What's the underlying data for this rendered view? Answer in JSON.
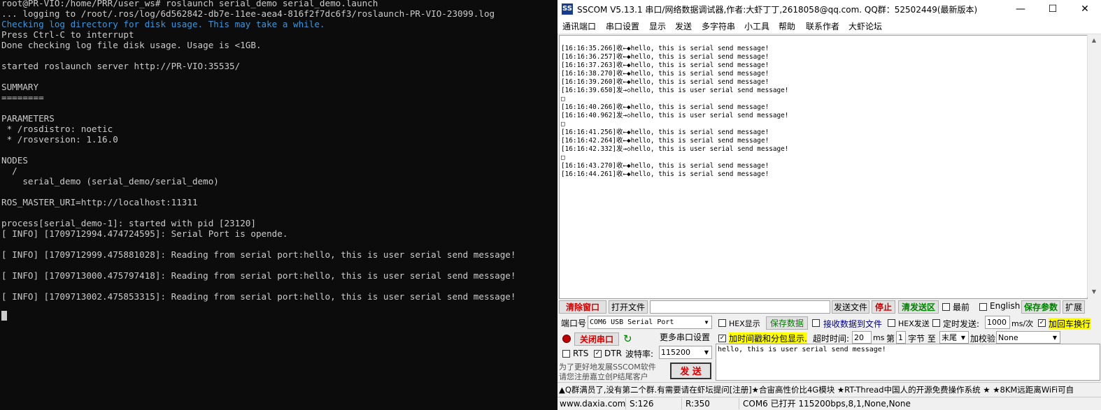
{
  "terminal": {
    "lines": [
      "root@PR-VIO:/home/PRR/user_ws# roslaunch serial_demo serial_demo.launch",
      "... logging to /root/.ros/log/6d562842-db7e-11ee-aea4-816f2f7dc6f3/roslaunch-PR-VIO-23099.log",
      "Checking log directory for disk usage. This may take a while.",
      "Press Ctrl-C to interrupt",
      "Done checking log file disk usage. Usage is <1GB.",
      "",
      "started roslaunch server http://PR-VIO:35535/",
      "",
      "SUMMARY",
      "========",
      "",
      "PARAMETERS",
      " * /rosdistro: noetic",
      " * /rosversion: 1.16.0",
      "",
      "NODES",
      "  /",
      "    serial_demo (serial_demo/serial_demo)",
      "",
      "ROS_MASTER_URI=http://localhost:11311",
      "",
      "process[serial_demo-1]: started with pid [23120]",
      "[ INFO] [1709712994.474724595]: Serial Port is opende.",
      "",
      "[ INFO] [1709712999.475881028]: Reading from serial port:hello, this is user serial send message!",
      "",
      "[ INFO] [1709713000.475797418]: Reading from serial port:hello, this is user serial send message!",
      "",
      "[ INFO] [1709713002.475853315]: Reading from serial port:hello, this is user serial send message!"
    ]
  },
  "sscom": {
    "title": "SSCOM V5.13.1 串口/网络数据调试器,作者:大虾丁丁,2618058@qq.com. QQ群：52502449(最新版本)",
    "app_icon": "SS",
    "window_buttons": {
      "minimize": "—",
      "maximize": "☐",
      "close": "✕"
    },
    "menu": [
      "通讯端口",
      "串口设置",
      "显示",
      "发送",
      "多字符串",
      "小工具",
      "帮助",
      "联系作者",
      "大虾论坛"
    ],
    "log": [
      "[16:16:35.266]收←◆hello, this is serial send message!",
      "[16:16:36.257]收←◆hello, this is serial send message!",
      "[16:16:37.263]收←◆hello, this is serial send message!",
      "[16:16:38.270]收←◆hello, this is serial send message!",
      "[16:16:39.260]收←◆hello, this is serial send message!",
      "[16:16:39.650]发→◇hello, this is user serial send message!",
      "□",
      "[16:16:40.266]收←◆hello, this is serial send message!",
      "[16:16:40.962]发→◇hello, this is user serial send message!",
      "□",
      "[16:16:41.256]收←◆hello, this is serial send message!",
      "[16:16:42.264]收←◆hello, this is serial send message!",
      "[16:16:42.332]发→◇hello, this is user serial send message!",
      "□",
      "[16:16:43.270]收←◆hello, this is serial send message!",
      "[16:16:44.261]收←◆hello, this is serial send message!"
    ],
    "row1": {
      "clear_window": "清除窗口",
      "open_file": "打开文件",
      "file_path": "",
      "send_file": "发送文件",
      "stop": "停止",
      "clear_send_area": "清发送区",
      "topmost": "最前",
      "english": "English",
      "save_params": "保存参数",
      "expand": "扩展"
    },
    "row2": {
      "port_label": "端口号",
      "port_value": "COM6 USB Serial Port",
      "hex_display": "HEX显示",
      "save_data": "保存数据",
      "recv_to_file": "接收数据到文件",
      "hex_send": "HEX发送",
      "timed_send": "定时发送:",
      "interval_value": "1000",
      "interval_unit": "ms/次",
      "add_crlf": "加回车换行"
    },
    "row3": {
      "close_port": "关闭串口",
      "more_settings": "更多串口设置",
      "timestamp_packet": "加时间戳和分包显示.",
      "timeout_label": "超时时间:",
      "timeout_value": "20",
      "timeout_unit": "ms",
      "page_label": "第",
      "byte_index": "1",
      "byte_label": "字节 至",
      "end_value": "末尾",
      "checksum_label": "加校验",
      "checksum_value": "None"
    },
    "row4": {
      "rts": "RTS",
      "dtr": "DTR",
      "baud_label": "波特率:",
      "baud_value": "115200"
    },
    "promo": {
      "line1": "为了更好地发展SSCOM软件",
      "line2": "请您注册嘉立创P结尾客户"
    },
    "send_button": "发 送",
    "send_text": "hello, this is user serial send message!",
    "marquee": "▲Q群满员了,没有第二个群.有需要请在虾坛提问[注册]★合宙高性价比4G模块 ★RT-Thread中国人的开源免费操作系统 ★ ★8KM远距离WiFi可自",
    "status": {
      "website": "www.daxia.com",
      "sent": "S:126",
      "received": "R:350",
      "port_status": "COM6 已打开  115200bps,8,1,None,None"
    }
  }
}
